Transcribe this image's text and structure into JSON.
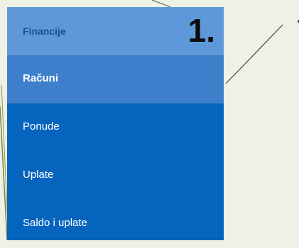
{
  "menu": {
    "header": {
      "title": "Financije",
      "step_number": "1."
    },
    "items": [
      {
        "label": "Računi",
        "active": true
      },
      {
        "label": "Ponude",
        "active": false
      },
      {
        "label": "Uplate",
        "active": false
      },
      {
        "label": "Saldo i uplate",
        "active": false
      }
    ]
  },
  "colors": {
    "background": "#eff0e6",
    "menu_background": "#0565be",
    "header_background": "#5e98d8",
    "active_item": "#3f80cc"
  }
}
